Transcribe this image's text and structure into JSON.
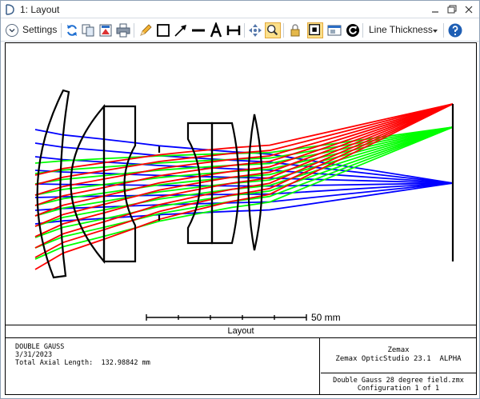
{
  "window": {
    "title": "1: Layout",
    "minimize_glyph": "—",
    "restore_glyph": "❐",
    "close_glyph": "✕"
  },
  "toolbar": {
    "settings_label": "Settings",
    "line_thickness_label": "Line Thickness",
    "icons": [
      "refresh-icon",
      "copy-icon",
      "save-icon",
      "print-icon",
      "pencil-icon",
      "rectangle-icon",
      "arrow-icon",
      "line-icon",
      "text-icon",
      "dimension-icon",
      "pan-icon",
      "zoom-icon",
      "lock-icon",
      "fit-icon",
      "window-icon",
      "rotate-icon",
      "help-icon"
    ]
  },
  "plot": {
    "scale_label": "50 mm",
    "ray_colors": {
      "field1": "#0000ff",
      "field2": "#00ff00",
      "field3": "#ff0000"
    },
    "lens_color": "#000000"
  },
  "panel": {
    "caption": "Layout",
    "system_name": "DOUBLE GAUSS",
    "date": "3/31/2023",
    "total_axial_length": "Total Axial Length:  132.98842 mm",
    "company": "Zemax",
    "product": "Zemax OpticStudio 23.1  ALPHA",
    "file_name": "Double Gauss 28 degree field.zmx",
    "configuration": "Configuration 1 of 1"
  }
}
